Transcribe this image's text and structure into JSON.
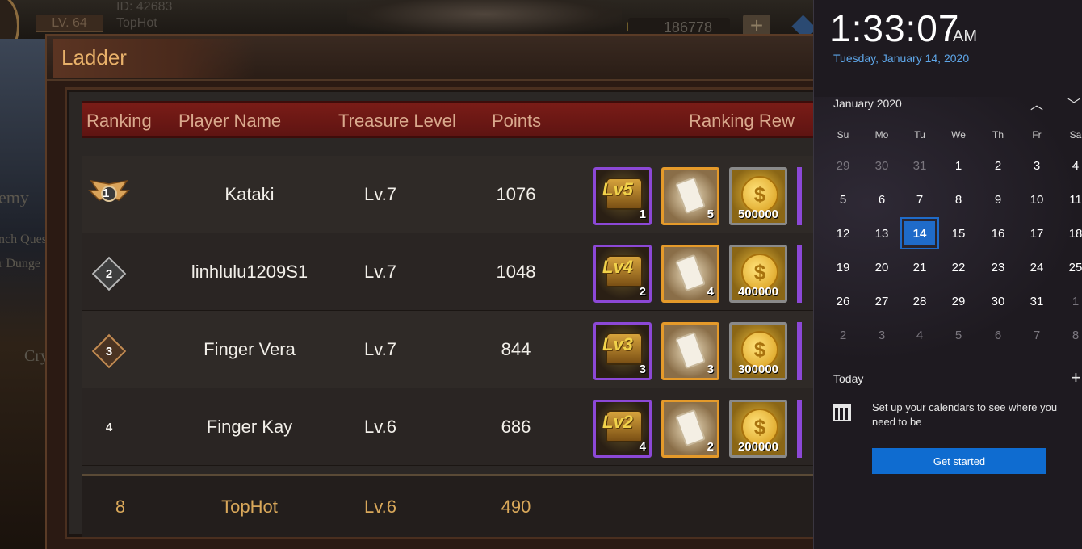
{
  "hud": {
    "level": "LV. 64",
    "player_id": "ID: 42683",
    "player_name": "TopHot",
    "gold": "186778",
    "plus": "+"
  },
  "side": {
    "labels": [
      "emy",
      "nch Ques",
      "r Dunge",
      "Cry"
    ]
  },
  "ladder": {
    "title": "Ladder",
    "headers": {
      "ranking": "Ranking",
      "player_name": "Player Name",
      "treasure_level": "Treasure Level",
      "points": "Points",
      "ranking_rewards": "Ranking Rew"
    },
    "rows": [
      {
        "rank": "1",
        "name": "Kataki",
        "level": "Lv.7",
        "points": "1076",
        "chest_lv": "Lv5",
        "chest_qty": "1",
        "scroll_qty": "5",
        "gold_amt": "500000"
      },
      {
        "rank": "2",
        "name": "linhlulu1209S1",
        "level": "Lv.7",
        "points": "1048",
        "chest_lv": "Lv4",
        "chest_qty": "2",
        "scroll_qty": "4",
        "gold_amt": "400000"
      },
      {
        "rank": "3",
        "name": "Finger Vera",
        "level": "Lv.7",
        "points": "844",
        "chest_lv": "Lv3",
        "chest_qty": "3",
        "scroll_qty": "3",
        "gold_amt": "300000"
      },
      {
        "rank": "4",
        "name": "Finger Kay",
        "level": "Lv.6",
        "points": "686",
        "chest_lv": "Lv2",
        "chest_qty": "4",
        "scroll_qty": "2",
        "gold_amt": "200000"
      }
    ],
    "me": {
      "rank": "8",
      "name": "TopHot",
      "level": "Lv.6",
      "points": "490"
    },
    "coin_symbol": "$"
  },
  "flyout": {
    "time": "1:33:07",
    "ampm": "AM",
    "date": "Tuesday, January 14, 2020",
    "month": "January 2020",
    "nav_up": "︿",
    "nav_down": "﹀",
    "dow": [
      "Su",
      "Mo",
      "Tu",
      "We",
      "Th",
      "Fr",
      "Sa"
    ],
    "days": [
      [
        "29",
        "30",
        "31",
        "1",
        "2",
        "3",
        "4"
      ],
      [
        "5",
        "6",
        "7",
        "8",
        "9",
        "10",
        "11"
      ],
      [
        "12",
        "13",
        "14",
        "15",
        "16",
        "17",
        "18"
      ],
      [
        "19",
        "20",
        "21",
        "22",
        "23",
        "24",
        "25"
      ],
      [
        "26",
        "27",
        "28",
        "29",
        "30",
        "31",
        "1"
      ],
      [
        "2",
        "3",
        "4",
        "5",
        "6",
        "7",
        "8"
      ]
    ],
    "today_label": "Today",
    "add_symbol": "+",
    "setup_text": "Set up your calendars to see where you need to be",
    "get_started": "Get started"
  }
}
